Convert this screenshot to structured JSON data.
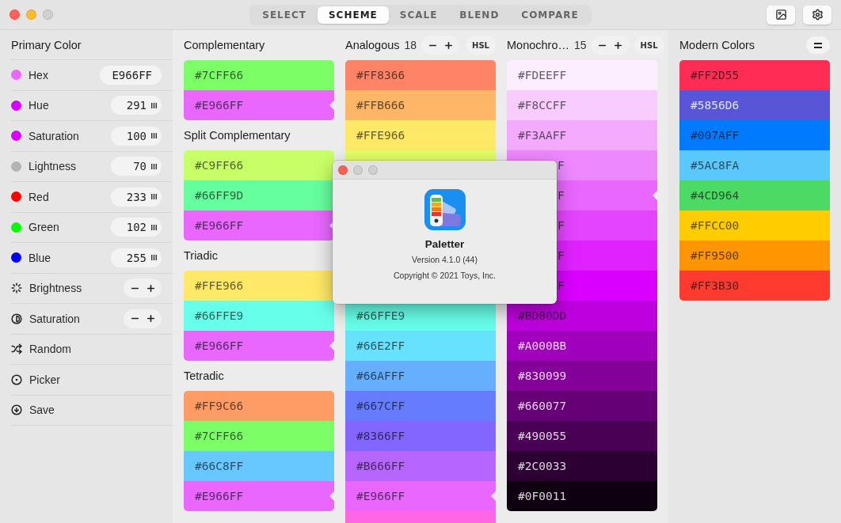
{
  "tabs": [
    {
      "label": "SELECT",
      "selected": false
    },
    {
      "label": "SCHEME",
      "selected": true
    },
    {
      "label": "SCALE",
      "selected": false
    },
    {
      "label": "BLEND",
      "selected": false
    },
    {
      "label": "COMPARE",
      "selected": false
    }
  ],
  "sidebar": {
    "title": "Primary Color",
    "items": [
      {
        "kind": "hex",
        "label": "Hex",
        "color": "#e966ff",
        "value": "E966FF"
      },
      {
        "kind": "value",
        "label": "Hue",
        "color": "#d900ff",
        "value": "291"
      },
      {
        "kind": "value",
        "label": "Saturation",
        "color": "#d900ff",
        "value": "100"
      },
      {
        "kind": "value",
        "label": "Lightness",
        "color": "#b3b3b3",
        "value": "70"
      },
      {
        "kind": "value",
        "label": "Red",
        "color": "#ff0000",
        "value": "233"
      },
      {
        "kind": "value",
        "label": "Green",
        "color": "#00ff00",
        "value": "102"
      },
      {
        "kind": "value",
        "label": "Blue",
        "color": "#0000ff",
        "value": "255"
      },
      {
        "kind": "adjust",
        "label": "Brightness"
      },
      {
        "kind": "adjust",
        "label": "Saturation"
      },
      {
        "kind": "action",
        "label": "Random"
      },
      {
        "kind": "action",
        "label": "Picker"
      },
      {
        "kind": "action",
        "label": "Save"
      }
    ]
  },
  "schemes": [
    {
      "title": "Complementary",
      "swatches": [
        {
          "hex": "#7CFF66",
          "color": "#7cff66",
          "selected": false
        },
        {
          "hex": "#E966FF",
          "color": "#e966ff",
          "selected": true
        }
      ]
    },
    {
      "title": "Split Complementary",
      "swatches": [
        {
          "hex": "#C9FF66",
          "color": "#c9ff66",
          "selected": false
        },
        {
          "hex": "#66FF9D",
          "color": "#66ff9d",
          "selected": false
        },
        {
          "hex": "#E966FF",
          "color": "#e966ff",
          "selected": true
        }
      ]
    },
    {
      "title": "Triadic",
      "swatches": [
        {
          "hex": "#FFE966",
          "color": "#ffe966",
          "selected": false
        },
        {
          "hex": "#66FFE9",
          "color": "#66ffe9",
          "selected": false
        },
        {
          "hex": "#E966FF",
          "color": "#e966ff",
          "selected": true
        }
      ]
    },
    {
      "title": "Tetradic",
      "swatches": [
        {
          "hex": "#FF9C66",
          "color": "#ff9c66",
          "selected": false
        },
        {
          "hex": "#7CFF66",
          "color": "#7cff66",
          "selected": false
        },
        {
          "hex": "#66C8FF",
          "color": "#66c8ff",
          "selected": false
        },
        {
          "hex": "#E966FF",
          "color": "#e966ff",
          "selected": true
        }
      ]
    }
  ],
  "analogous": {
    "title": "Analogous",
    "count": "18",
    "mode": "HSL",
    "swatches": [
      {
        "hex": "#FF8366",
        "color": "#ff8366",
        "selected": false
      },
      {
        "hex": "#FFB666",
        "color": "#ffb666",
        "selected": false
      },
      {
        "hex": "#FFE966",
        "color": "#ffe966",
        "selected": false
      },
      {
        "color": "#e3ff66"
      }
    ],
    "swatches_lower": [
      {
        "hex": "#66FFE9",
        "color": "#66ffe9",
        "selected": false
      },
      {
        "hex": "#66E2FF",
        "color": "#66e2ff",
        "selected": false
      },
      {
        "hex": "#66AFFF",
        "color": "#66afff",
        "selected": false
      },
      {
        "hex": "#667CFF",
        "color": "#667cff",
        "selected": false
      },
      {
        "hex": "#8366FF",
        "color": "#8366ff",
        "selected": false
      },
      {
        "hex": "#B666FF",
        "color": "#b666ff",
        "selected": false
      },
      {
        "hex": "#E966FF",
        "color": "#e966ff",
        "selected": true
      },
      {
        "color": "#ff66e3"
      }
    ]
  },
  "monochromatic": {
    "title": "Monochro…",
    "count": "15",
    "mode": "HSL",
    "swatches": [
      {
        "hex": "#FDEEFF",
        "color": "#fdeeff",
        "selected": false
      },
      {
        "hex": "#F8CCFF",
        "color": "#f8ccff",
        "selected": false
      },
      {
        "hex": "#F3AAFF",
        "color": "#f3aaff",
        "selected": false
      },
      {
        "fragment": "F",
        "color": "#ee88ff",
        "selected": false
      },
      {
        "fragment": "F",
        "color": "#e966ff",
        "selected": true
      },
      {
        "fragment": "F",
        "color": "#e444ff",
        "selected": false
      },
      {
        "fragment": "F",
        "color": "#df22ff",
        "selected": false
      },
      {
        "fragment": "F",
        "color": "#da00ff",
        "selected": false
      },
      {
        "hex": "#BD00DD",
        "color": "#bd00dd",
        "selected": false
      },
      {
        "hex": "#A000BB",
        "color": "#a000bb",
        "selected": false
      },
      {
        "hex": "#830099",
        "color": "#830099",
        "selected": false
      },
      {
        "hex": "#660077",
        "color": "#660077",
        "selected": false
      },
      {
        "hex": "#490055",
        "color": "#490055",
        "selected": false
      },
      {
        "hex": "#2C0033",
        "color": "#2c0033",
        "selected": false
      },
      {
        "hex": "#0F0011",
        "color": "#0f0011",
        "selected": false
      }
    ]
  },
  "modern": {
    "title": "Modern Colors",
    "swatches": [
      {
        "hex": "#FF2D55",
        "color": "#ff2d55",
        "selected": false
      },
      {
        "hex": "#5856D6",
        "color": "#5856d6",
        "selected": false
      },
      {
        "hex": "#007AFF",
        "color": "#007aff",
        "selected": false
      },
      {
        "hex": "#5AC8FA",
        "color": "#5ac8fa",
        "selected": false
      },
      {
        "hex": "#4CD964",
        "color": "#4cd964",
        "selected": false
      },
      {
        "hex": "#FFCC00",
        "color": "#ffcc00",
        "selected": false
      },
      {
        "hex": "#FF9500",
        "color": "#ff9500",
        "selected": false
      },
      {
        "hex": "#FF3B30",
        "color": "#ff3b30",
        "selected": false
      }
    ]
  },
  "about": {
    "app_name": "Paletter",
    "version": "Version 4.1.0 (44)",
    "copyright": "Copyright © 2021 Toys, Inc."
  }
}
